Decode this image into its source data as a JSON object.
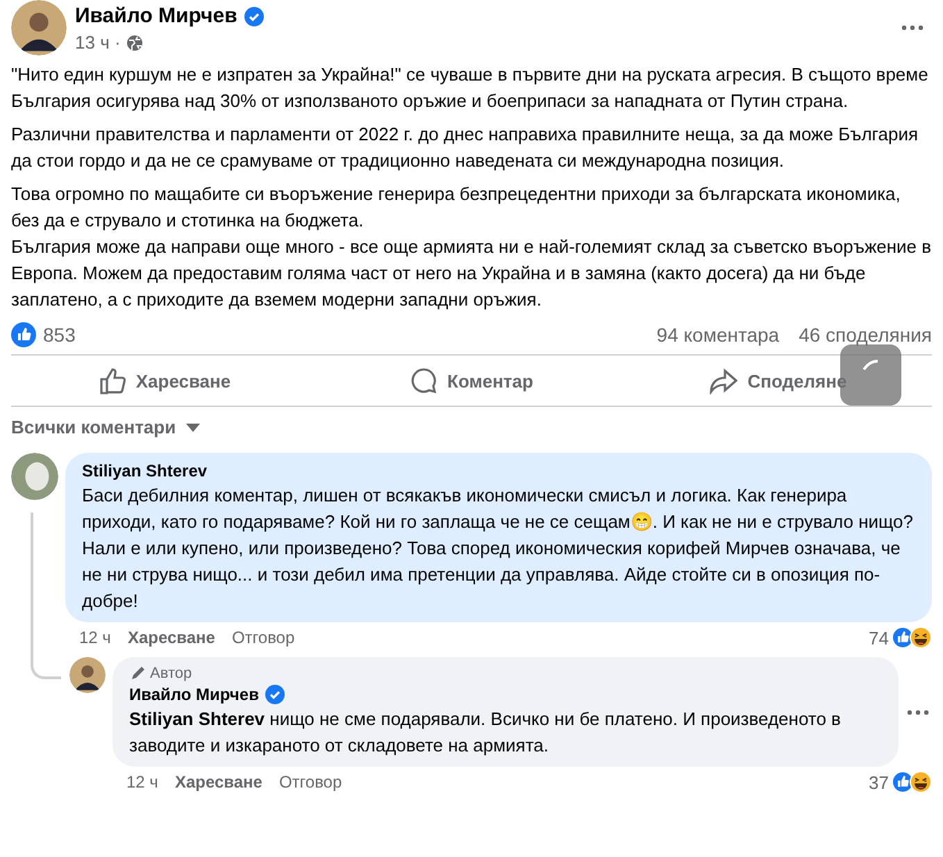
{
  "post": {
    "author": "Ивайло Мирчев",
    "verified": true,
    "time": "13 ч ·",
    "paragraphs": [
      "\"Нито един куршум не е изпратен за Украйна!\" се чуваше в първите дни на руската агресия. В същото време България осигурява над 30% от използваното оръжие и боеприпаси за нападната от Путин страна.",
      "Различни правителства и парламенти от 2022 г. до днес направиха правилните неща, за да може България да стои гордо и да не се срамуваме от традиционно наведената си международна позиция.",
      "Това огромно по мащабите си въоръжение генерира безпрецедентни приходи за българската икономика, без да е струвало и стотинка на бюджета.\nБългария може да направи още много - все още армията ни е най-големият склад за съветско въоръжение в Европа. Можем да предоставим голяма част от него на Украйна и в замяна (както досега) да ни бъде заплатено, а с приходите да вземем модерни западни оръжия."
    ],
    "reactions": "853",
    "comments_count": "94 коментара",
    "shares_count": "46 споделяния",
    "actions": [
      {
        "kind": "like",
        "label": "Харесване"
      },
      {
        "kind": "comment",
        "label": "Коментар"
      },
      {
        "kind": "share",
        "label": "Споделяне"
      }
    ],
    "loading": true
  },
  "comments_filter": "Всички коментари",
  "comments": [
    {
      "author": "Stiliyan Shterev",
      "verified": false,
      "highlighted": true,
      "text": "Баси дебилния коментар, лишен от всякакъв икономически смисъл и логика. Как генерира приходи, като го подаряваме? Кой ни го заплаща че не се сещам😁. И как не ни е струвало нищо? Нали е или купено, или произведено? Това според икономическия корифей Мирчев означава, че не ни струва нищо... и този дебил има претенции да управлява. Айде стойте си в опозиция по-добре!",
      "time": "12 ч",
      "like": "Харесване",
      "reply": "Отговор",
      "reactions": "74",
      "reply_level": false
    },
    {
      "author": "Ивайло Мирчев",
      "author_badge": "Автор",
      "verified": true,
      "highlighted": false,
      "mention": "Stiliyan Shterev",
      "text": " нищо не сме подарявали. Всичко ни бе платено. И произведеното в заводите и изкараното от складовете на армията.",
      "time": "12 ч",
      "like": "Харесване",
      "reply": "Отговор",
      "reactions": "37",
      "reply_level": true
    }
  ]
}
